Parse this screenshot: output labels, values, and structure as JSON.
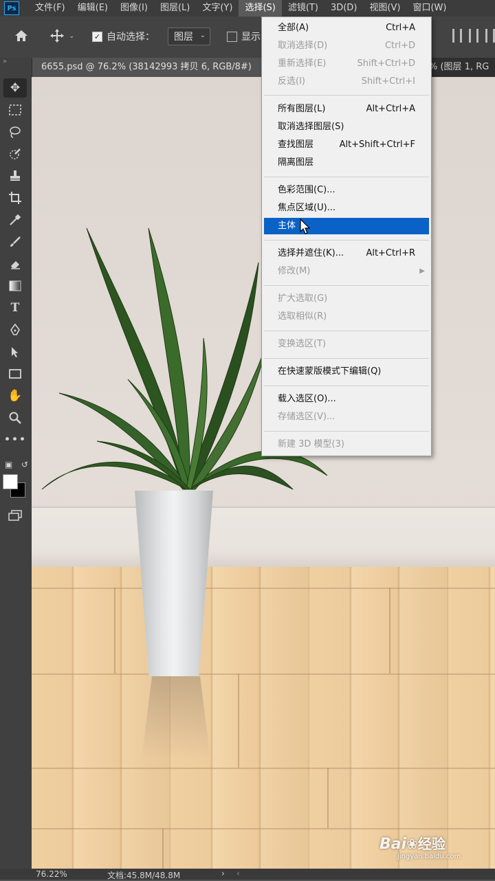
{
  "app": {
    "logo_text": "Ps"
  },
  "menubar": {
    "items": [
      "文件(F)",
      "编辑(E)",
      "图像(I)",
      "图层(L)",
      "文字(Y)",
      "选择(S)",
      "滤镜(T)",
      "3D(D)",
      "视图(V)",
      "窗口(W)"
    ],
    "active_index": 5
  },
  "options": {
    "auto_select_label": "自动选择：",
    "auto_select_checked": true,
    "auto_select_target": "图层",
    "show_label": "显示"
  },
  "document_tab": {
    "title": "6655.psd @ 76.2% (38142993 拷贝 6, RGB/8#)",
    "other_tab": "% (图层 1, RG"
  },
  "select_menu": {
    "items": [
      {
        "label": "全部(A)",
        "shortcut": "Ctrl+A",
        "enabled": true
      },
      {
        "label": "取消选择(D)",
        "shortcut": "Ctrl+D",
        "enabled": false
      },
      {
        "label": "重新选择(E)",
        "shortcut": "Shift+Ctrl+D",
        "enabled": false
      },
      {
        "label": "反选(I)",
        "shortcut": "Shift+Ctrl+I",
        "enabled": false
      },
      {
        "label": "所有图层(L)",
        "shortcut": "Alt+Ctrl+A",
        "enabled": true
      },
      {
        "label": "取消选择图层(S)",
        "shortcut": "",
        "enabled": true
      },
      {
        "label": "查找图层",
        "shortcut": "Alt+Shift+Ctrl+F",
        "enabled": true
      },
      {
        "label": "隔离图层",
        "shortcut": "",
        "enabled": true
      },
      {
        "label": "色彩范围(C)...",
        "shortcut": "",
        "enabled": true
      },
      {
        "label": "焦点区域(U)...",
        "shortcut": "",
        "enabled": true
      },
      {
        "label": "主体",
        "shortcut": "",
        "enabled": true,
        "highlighted": true
      },
      {
        "label": "选择并遮住(K)...",
        "shortcut": "Alt+Ctrl+R",
        "enabled": true
      },
      {
        "label": "修改(M)",
        "shortcut": "",
        "enabled": false,
        "submenu": true
      },
      {
        "label": "扩大选取(G)",
        "shortcut": "",
        "enabled": false
      },
      {
        "label": "选取相似(R)",
        "shortcut": "",
        "enabled": false
      },
      {
        "label": "变换选区(T)",
        "shortcut": "",
        "enabled": false
      },
      {
        "label": "在快速蒙版模式下编辑(Q)",
        "shortcut": "",
        "enabled": true
      },
      {
        "label": "载入选区(O)...",
        "shortcut": "",
        "enabled": true
      },
      {
        "label": "存储选区(V)...",
        "shortcut": "",
        "enabled": false
      },
      {
        "label": "新建 3D 模型(3)",
        "shortcut": "",
        "enabled": false
      }
    ]
  },
  "statusbar": {
    "zoom": "76.22%",
    "doc_info": "文档:45.8M/48.8M"
  },
  "watermark": {
    "brand": "Bai",
    "brand_cn": "经验",
    "url": "jingyan.baidu.com"
  },
  "colors": {
    "highlight": "#0a62c6",
    "ps_blue": "#31a8ff"
  }
}
